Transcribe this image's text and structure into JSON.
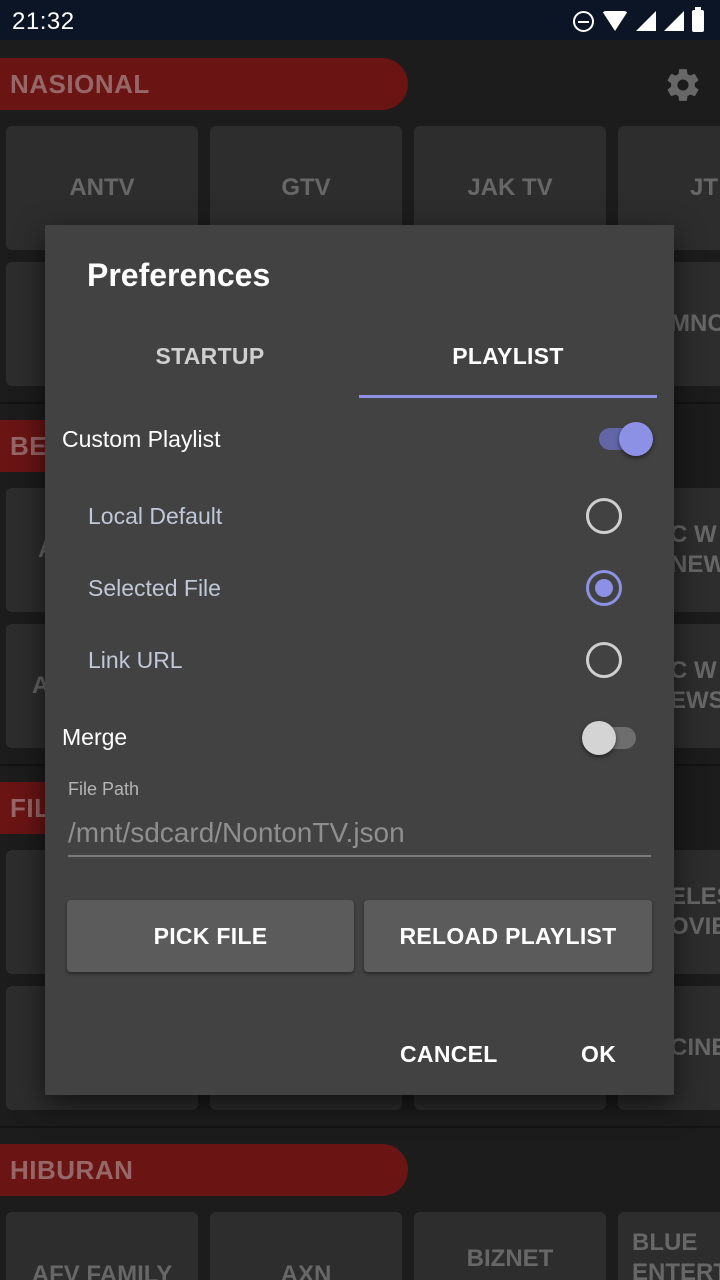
{
  "status_bar": {
    "time": "21:32",
    "icons": [
      "do-not-disturb-icon",
      "wifi-icon",
      "signal-icon",
      "signal-icon",
      "battery-icon"
    ]
  },
  "background": {
    "categories": [
      {
        "label": "NASIONAL"
      },
      {
        "label": "BE"
      },
      {
        "label": "FIL"
      },
      {
        "label": "HIBURAN"
      }
    ],
    "tiles": {
      "row1": [
        "ANTV",
        "GTV",
        "JAK TV",
        "JT"
      ],
      "row2_right": "MNC",
      "row3_left": "A",
      "row3_right": "C W\nNEW",
      "row4_left": "A",
      "row4_right": "C W\nEWS",
      "row5_right": "ELES\nOVIE",
      "row6_right": "CINE",
      "row7": [
        "AFV FAMILY",
        "AXN",
        "BIZNET",
        "BLUE\nENTERT"
      ]
    },
    "settings_icon": "gear-icon"
  },
  "dialog": {
    "title": "Preferences",
    "tabs": [
      {
        "label": "STARTUP",
        "selected": false
      },
      {
        "label": "PLAYLIST",
        "selected": true
      }
    ],
    "custom_playlist": {
      "label": "Custom Playlist",
      "enabled": true
    },
    "options": [
      {
        "label": "Local Default",
        "selected": false
      },
      {
        "label": "Selected File",
        "selected": true
      },
      {
        "label": "Link URL",
        "selected": false
      }
    ],
    "merge": {
      "label": "Merge",
      "enabled": false
    },
    "file_path": {
      "label": "File Path",
      "value": "/mnt/sdcard/NontonTV.json"
    },
    "pick_file_label": "PICK FILE",
    "reload_label": "RELOAD PLAYLIST",
    "cancel_label": "CANCEL",
    "ok_label": "OK"
  },
  "colors": {
    "accent": "#8c91e6",
    "category_red": "#8e1b1b",
    "dialog_bg": "#424242",
    "status_bar": "#0b1526"
  }
}
